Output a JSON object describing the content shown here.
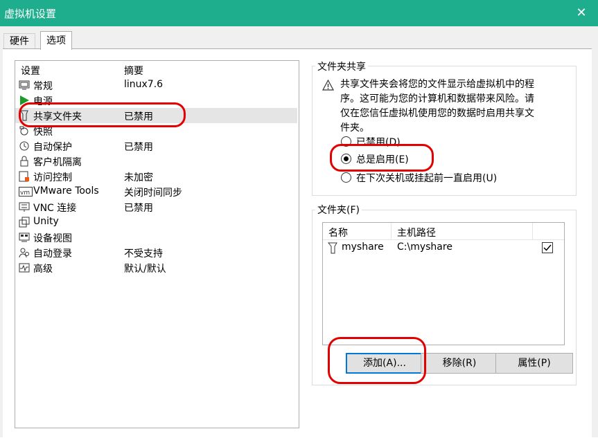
{
  "window": {
    "title": "虚拟机设置"
  },
  "tabs": [
    {
      "label": "硬件"
    },
    {
      "label": "选项"
    }
  ],
  "settings_list": {
    "headers": {
      "setting": "设置",
      "summary": "摘要"
    },
    "items": [
      {
        "label": "常规",
        "summary": "linux7.6",
        "icon": "general-icon"
      },
      {
        "label": "电源",
        "summary": "",
        "icon": "power-icon"
      },
      {
        "label": "共享文件夹",
        "summary": "已禁用",
        "icon": "shared-folder-icon"
      },
      {
        "label": "快照",
        "summary": "",
        "icon": "snapshot-icon"
      },
      {
        "label": "自动保护",
        "summary": "已禁用",
        "icon": "autoprotect-icon"
      },
      {
        "label": "客户机隔离",
        "summary": "",
        "icon": "lock-icon"
      },
      {
        "label": "访问控制",
        "summary": "未加密",
        "icon": "access-control-icon"
      },
      {
        "label": "VMware Tools",
        "summary": "关闭时间同步",
        "icon": "vmware-tools-icon"
      },
      {
        "label": "VNC 连接",
        "summary": "已禁用",
        "icon": "vnc-icon"
      },
      {
        "label": "Unity",
        "summary": "",
        "icon": "unity-icon"
      },
      {
        "label": "设备视图",
        "summary": "",
        "icon": "device-view-icon"
      },
      {
        "label": "自动登录",
        "summary": "不受支持",
        "icon": "autologin-icon"
      },
      {
        "label": "高级",
        "summary": "默认/默认",
        "icon": "advanced-icon"
      }
    ]
  },
  "folder_sharing": {
    "group_title": "文件夹共享",
    "warning": "共享文件夹会将您的文件显示给虚拟机中的程序。这可能为您的计算机和数据带来风险。请仅在您信任虚拟机使用您的数据时启用共享文件夹。",
    "options": [
      {
        "label": "已禁用(D)",
        "checked": false
      },
      {
        "label": "总是启用(E)",
        "checked": true
      },
      {
        "label": "在下次关机或挂起前一直启用(U)",
        "checked": false
      }
    ]
  },
  "folders": {
    "group_title": "文件夹(F)",
    "headers": {
      "name": "名称",
      "host_path": "主机路径"
    },
    "rows": [
      {
        "name": "myshare",
        "path": "C:\\myshare",
        "enabled": true
      }
    ],
    "buttons": {
      "add": "添加(A)...",
      "remove": "移除(R)",
      "properties": "属性(P)"
    }
  },
  "annotation_color": "#e30000"
}
